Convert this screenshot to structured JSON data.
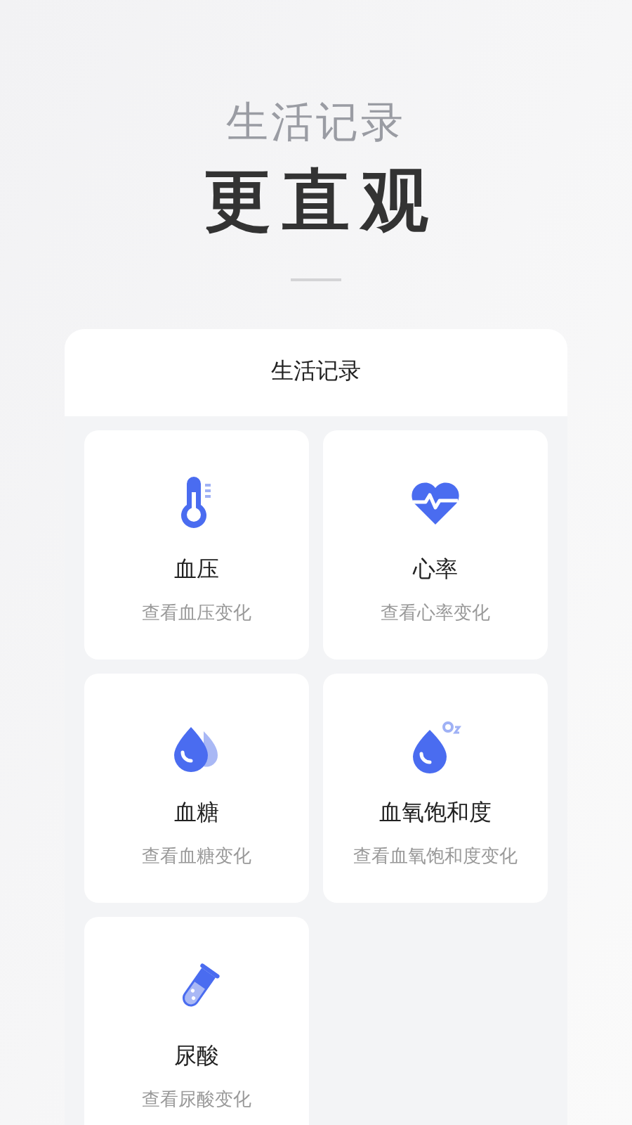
{
  "headline": {
    "subtitle": "生活记录",
    "title": "更直观"
  },
  "panel": {
    "title": "生活记录",
    "items": [
      {
        "kind": "thermometer",
        "name": "血压",
        "hint": "查看血压变化"
      },
      {
        "kind": "heart",
        "name": "心率",
        "hint": "查看心率变化"
      },
      {
        "kind": "drops",
        "name": "血糖",
        "hint": "查看血糖变化"
      },
      {
        "kind": "oxygen",
        "name": "血氧饱和度",
        "hint": "查看血氧饱和度变化"
      },
      {
        "kind": "tube",
        "name": "尿酸",
        "hint": "查看尿酸变化"
      }
    ]
  }
}
